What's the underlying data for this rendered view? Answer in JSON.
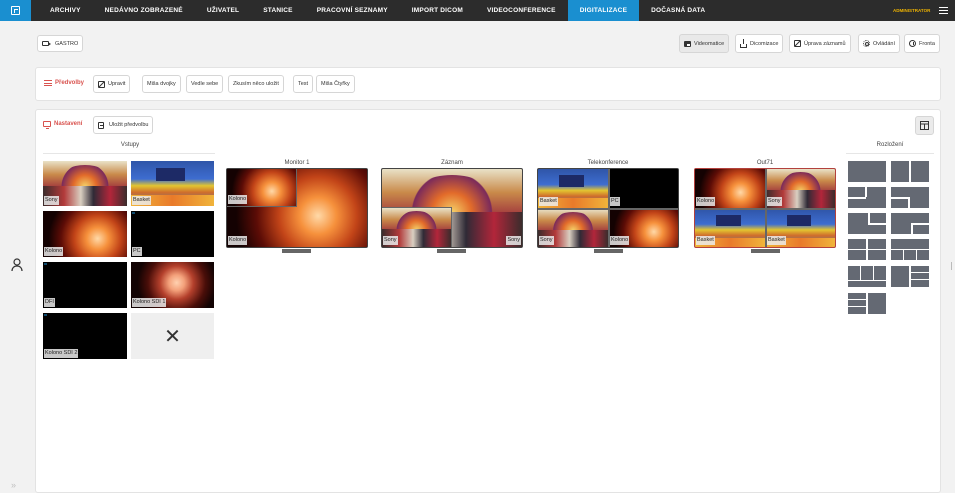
{
  "nav": {
    "items": [
      "ARCHIVY",
      "NEDÁVNO ZOBRAZENÉ",
      "UŽIVATEL",
      "STANICE",
      "PRACOVNÍ SEZNAMY",
      "IMPORT DICOM",
      "VIDEOCONFERENCE",
      "DIGITALIZACE",
      "DOČASNÁ DATA"
    ],
    "active": "DIGITALIZACE",
    "user": "ADMINISTRATOR"
  },
  "toolbar": {
    "source_button": "GASTRO",
    "right_buttons": [
      "Videomatice",
      "Dicomizace",
      "Úprava záznamů",
      "Ovládání",
      "Fronta"
    ]
  },
  "presets": {
    "title": "Předvolby",
    "edit_button": "Upravit",
    "items": [
      "Miša dvojky",
      "Vedle sebe",
      "Zkusím něco uložit",
      "Test",
      "Miša Čtyřky"
    ]
  },
  "settings": {
    "title": "Nastavení",
    "save_button": "Uložit předvolbu"
  },
  "inputs": {
    "title": "Vstupy",
    "tiles": [
      "Sony",
      "Basket",
      "Kolono",
      "PC",
      "DFI",
      "Kolono SDI 1",
      "Kolono SDI 2",
      ""
    ]
  },
  "outputs": [
    {
      "title": "Monitor 1",
      "labels": [
        "Kolono",
        "Kolono"
      ]
    },
    {
      "title": "Záznam",
      "labels": [
        "Sony",
        "Sony"
      ]
    },
    {
      "title": "Telekonference",
      "labels": [
        "Basket",
        "PC",
        "Sony",
        "Kolono"
      ]
    },
    {
      "title": "Out71",
      "labels": [
        "Kolono",
        "Sony",
        "Basket",
        "Basket"
      ]
    }
  ],
  "layouts": {
    "title": "Rozložení"
  },
  "colors": {
    "accent": "#1a8fd0",
    "topbar": "#2c2c2c",
    "section_red": "#d9534f",
    "admin": "#f0b400"
  }
}
